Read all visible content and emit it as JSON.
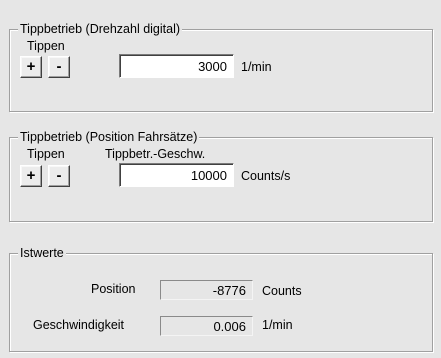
{
  "drehzahl": {
    "title": "Tippbetrieb (Drehzahl digital)",
    "tippen_label": "Tippen",
    "plus_label": "+",
    "minus_label": "-",
    "value": "3000",
    "unit": "1/min"
  },
  "position": {
    "title": "Tippbetrieb (Position Fahrsätze)",
    "tippen_label": "Tippen",
    "speed_label": "Tippbetr.-Geschw.",
    "plus_label": "+",
    "minus_label": "-",
    "value": "10000",
    "unit": "Counts/s"
  },
  "istwerte": {
    "title": "Istwerte",
    "position_label": "Position",
    "position_value": "-8776",
    "position_unit": "Counts",
    "speed_label": "Geschwindigkeit",
    "speed_value": "0.006",
    "speed_unit": "1/min"
  }
}
